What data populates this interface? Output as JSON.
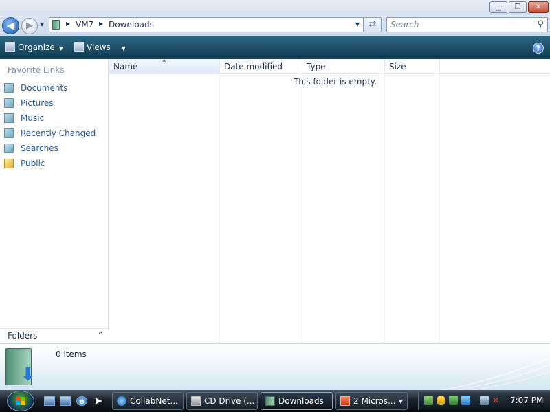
{
  "window": {
    "caption_buttons": {
      "minimize": "▁",
      "maximize": "❐",
      "close": "✕"
    }
  },
  "address": {
    "crumbs": [
      "VM7",
      "Downloads"
    ],
    "search_placeholder": "Search"
  },
  "commandbar": {
    "organize_label": "Organize",
    "views_label": "Views",
    "help_label": "?"
  },
  "navpane": {
    "title": "Favorite Links",
    "items": [
      {
        "label": "Documents",
        "icon": "documents-icon"
      },
      {
        "label": "Pictures",
        "icon": "pictures-icon"
      },
      {
        "label": "Music",
        "icon": "music-icon"
      },
      {
        "label": "Recently Changed",
        "icon": "recently-changed-icon"
      },
      {
        "label": "Searches",
        "icon": "searches-icon"
      },
      {
        "label": "Public",
        "icon": "public-folder-icon"
      }
    ],
    "folders_label": "Folders"
  },
  "filelist": {
    "columns": [
      "Name",
      "Date modified",
      "Type",
      "Size"
    ],
    "empty_message": "This folder is empty."
  },
  "details": {
    "items_count": "0 items"
  },
  "taskbar": {
    "tasks": [
      {
        "label": "CollabNet...",
        "icon": "ie-icon"
      },
      {
        "label": "CD Drive (...",
        "icon": "cd-drive-icon"
      },
      {
        "label": "Downloads",
        "icon": "folder-icon",
        "active": true
      },
      {
        "label": "2 Micros...",
        "icon": "office-icon",
        "grouped": true
      }
    ],
    "clock": "7:07 PM"
  }
}
